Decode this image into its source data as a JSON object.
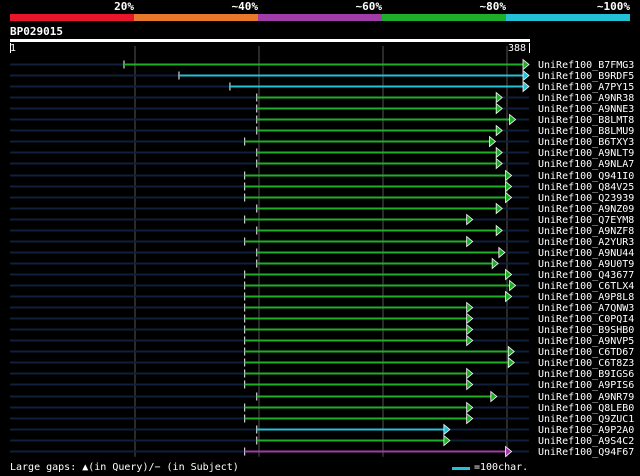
{
  "legend": {
    "labels": [
      "20%",
      "~40%",
      "~60%",
      "~80%",
      "~100%"
    ],
    "colors": [
      "#e8162a",
      "#e8782a",
      "#a23ca8",
      "#1fae28",
      "#22c1d6"
    ]
  },
  "query": {
    "id": "BP029015",
    "start": "1",
    "end": "388",
    "length": 388
  },
  "footer": {
    "gaps_text": "Large gaps: ▲(in Query)/− (in Subject)",
    "scale_text": "=100char."
  },
  "hits": [
    {
      "name": "UniRef100_B7FMG3",
      "start": 86,
      "end": 388,
      "color": "#1fae28"
    },
    {
      "name": "UniRef100_B9RDF5",
      "start": 127,
      "end": 388,
      "color": "#22c1d6"
    },
    {
      "name": "UniRef100_A7PY15",
      "start": 165,
      "end": 388,
      "color": "#22c1d6"
    },
    {
      "name": "UniRef100_A9NR38",
      "start": 185,
      "end": 368,
      "color": "#1fae28"
    },
    {
      "name": "UniRef100_A9NNE3",
      "start": 185,
      "end": 368,
      "color": "#1fae28"
    },
    {
      "name": "UniRef100_B8LMT8",
      "start": 185,
      "end": 378,
      "color": "#1fae28"
    },
    {
      "name": "UniRef100_B8LMU9",
      "start": 185,
      "end": 368,
      "color": "#1fae28"
    },
    {
      "name": "UniRef100_B6TXY3",
      "start": 176,
      "end": 363,
      "color": "#1fae28"
    },
    {
      "name": "UniRef100_A9NLT9",
      "start": 185,
      "end": 368,
      "color": "#1fae28"
    },
    {
      "name": "UniRef100_A9NLA7",
      "start": 185,
      "end": 368,
      "color": "#1fae28"
    },
    {
      "name": "UniRef100_Q941I0",
      "start": 176,
      "end": 375,
      "color": "#1fae28"
    },
    {
      "name": "UniRef100_Q84V25",
      "start": 176,
      "end": 375,
      "color": "#1fae28"
    },
    {
      "name": "UniRef100_Q23939",
      "start": 176,
      "end": 375,
      "color": "#1fae28"
    },
    {
      "name": "UniRef100_A9NZ09",
      "start": 185,
      "end": 368,
      "color": "#1fae28"
    },
    {
      "name": "UniRef100_Q7EYM8",
      "start": 176,
      "end": 346,
      "color": "#1fae28"
    },
    {
      "name": "UniRef100_A9NZF8",
      "start": 185,
      "end": 368,
      "color": "#1fae28"
    },
    {
      "name": "UniRef100_A2YUR3",
      "start": 176,
      "end": 346,
      "color": "#1fae28"
    },
    {
      "name": "UniRef100_A9NU44",
      "start": 185,
      "end": 370,
      "color": "#1fae28"
    },
    {
      "name": "UniRef100_A9U0T9",
      "start": 185,
      "end": 365,
      "color": "#1fae28"
    },
    {
      "name": "UniRef100_Q43677",
      "start": 176,
      "end": 375,
      "color": "#1fae28"
    },
    {
      "name": "UniRef100_C6TLX4",
      "start": 176,
      "end": 378,
      "color": "#1fae28"
    },
    {
      "name": "UniRef100_A9P8L8",
      "start": 176,
      "end": 375,
      "color": "#1fae28"
    },
    {
      "name": "UniRef100_A7QNW3",
      "start": 176,
      "end": 346,
      "color": "#1fae28"
    },
    {
      "name": "UniRef100_C0PQI4",
      "start": 176,
      "end": 346,
      "color": "#1fae28"
    },
    {
      "name": "UniRef100_B9SHB0",
      "start": 176,
      "end": 346,
      "color": "#1fae28"
    },
    {
      "name": "UniRef100_A9NVP5",
      "start": 176,
      "end": 346,
      "color": "#1fae28"
    },
    {
      "name": "UniRef100_C6TD67",
      "start": 176,
      "end": 377,
      "color": "#1fae28"
    },
    {
      "name": "UniRef100_C6T8Z3",
      "start": 176,
      "end": 377,
      "color": "#1fae28"
    },
    {
      "name": "UniRef100_B9IGS6",
      "start": 176,
      "end": 346,
      "color": "#1fae28"
    },
    {
      "name": "UniRef100_A9PIS6",
      "start": 176,
      "end": 346,
      "color": "#1fae28"
    },
    {
      "name": "UniRef100_A9NR79",
      "start": 185,
      "end": 364,
      "color": "#1fae28"
    },
    {
      "name": "UniRef100_Q8LEB0",
      "start": 176,
      "end": 346,
      "color": "#1fae28"
    },
    {
      "name": "UniRef100_Q9ZUC1",
      "start": 176,
      "end": 346,
      "color": "#1fae28"
    },
    {
      "name": "UniRef100_A9P2A0",
      "start": 185,
      "end": 329,
      "color": "#22c1d6"
    },
    {
      "name": "UniRef100_A9S4C2",
      "start": 185,
      "end": 329,
      "color": "#1fae28"
    },
    {
      "name": "UniRef100_Q94F67",
      "start": 176,
      "end": 375,
      "color": "#a23ca8"
    }
  ]
}
